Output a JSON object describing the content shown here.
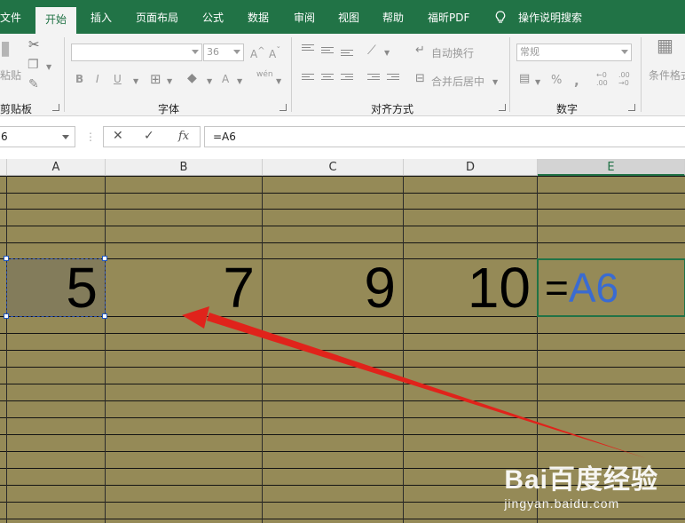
{
  "ribbon_tabs": [
    {
      "label": "文件"
    },
    {
      "label": "开始"
    },
    {
      "label": "插入"
    },
    {
      "label": "页面布局"
    },
    {
      "label": "公式"
    },
    {
      "label": "数据"
    },
    {
      "label": "审阅"
    },
    {
      "label": "视图"
    },
    {
      "label": "帮助"
    },
    {
      "label": "福昕PDF"
    }
  ],
  "tell_me": "操作说明搜索",
  "groups": {
    "clipboard": {
      "label": "剪贴板",
      "paste_label": "粘贴"
    },
    "font": {
      "label": "字体",
      "font_name": "",
      "font_size": "36",
      "phonetic": "wén"
    },
    "alignment": {
      "label": "对齐方式",
      "wrap_text": "自动换行",
      "merge_center": "合并后居中"
    },
    "number": {
      "label": "数字",
      "format": "常规"
    },
    "styles": {
      "cond_format": "条件格式"
    }
  },
  "formula_bar": {
    "name_box": "6",
    "formula": "=A6"
  },
  "columns": [
    "A",
    "B",
    "C",
    "D",
    "E"
  ],
  "selected_column": "E",
  "cells": {
    "A6": "5",
    "B6": "7",
    "C6": "9",
    "D6": "10",
    "E6": {
      "prefix": "=",
      "ref": "A6"
    }
  },
  "colors": {
    "ribbon_green": "#217346",
    "cell_fill": "#958a57",
    "copy_source_fill": "#837c5b",
    "formula_ref_blue": "#3a6bd1",
    "arrow_red": "#e0231b"
  },
  "watermark": {
    "logo": "Bai百度经验",
    "url": "jingyan.baidu.com"
  }
}
